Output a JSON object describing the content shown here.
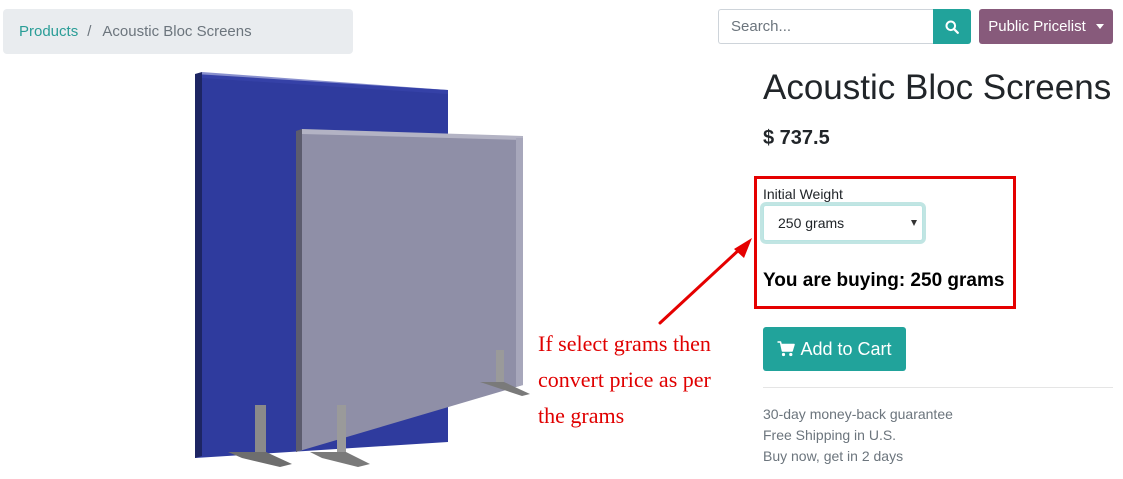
{
  "breadcrumb": {
    "items": [
      {
        "label": "Products"
      },
      {
        "label": "Acoustic Bloc Screens"
      }
    ],
    "separator": "/"
  },
  "header": {
    "search_placeholder": "Search...",
    "search_icon": "search-icon",
    "pricelist_label": "Public Pricelist"
  },
  "product": {
    "title": "Acoustic Bloc Screens",
    "price": "$ 737.5",
    "attribute": {
      "label": "Initial Weight",
      "selected": "250 grams"
    },
    "buying_text": "You are buying: 250 grams",
    "add_to_cart_label": "Add to Cart",
    "cart_icon": "shopping-cart-icon",
    "benefits": [
      "30-day money-back guarantee",
      "Free Shipping in U.S.",
      "Buy now, get in 2 days"
    ]
  },
  "annotation": {
    "lines": [
      "If select grams then",
      "convert price as per",
      "the grams"
    ]
  },
  "colors": {
    "primary": "#21a39b",
    "pricelist": "#875a7b",
    "annotation": "#e50000",
    "link": "#2a9d97"
  }
}
